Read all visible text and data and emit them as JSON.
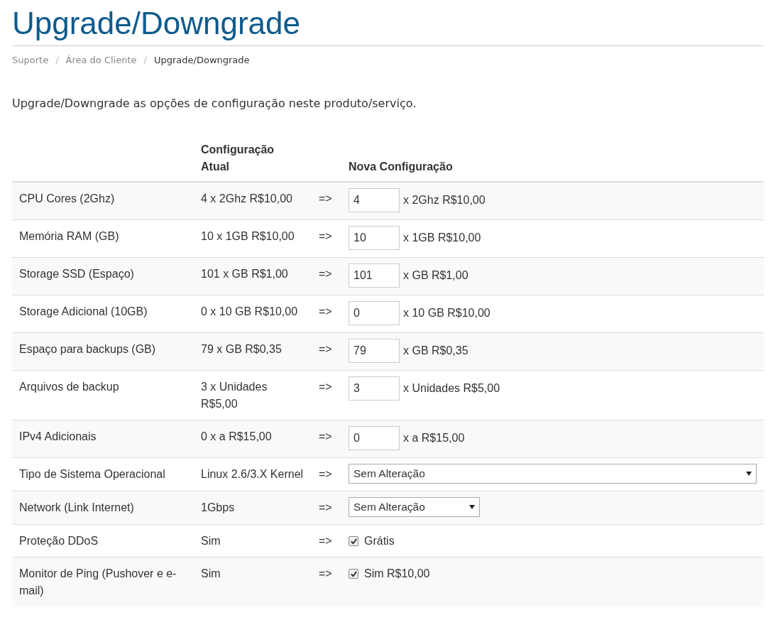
{
  "title": "Upgrade/Downgrade",
  "breadcrumb": [
    {
      "label": "Suporte",
      "current": false
    },
    {
      "label": "Área do Cliente",
      "current": false
    },
    {
      "label": "Upgrade/Downgrade",
      "current": true
    }
  ],
  "breadcrumb_separator": "/",
  "intro": "Upgrade/Downgrade as opções de configuração neste produto/serviço.",
  "table": {
    "columns": [
      "Configuração Atual",
      "Nova Configuração"
    ],
    "rows": [
      {
        "kind": "quantity",
        "label": "CPU Cores (2Ghz)",
        "current": "4 x 2Ghz R$10,00",
        "arrow": "=>",
        "value": "4",
        "suffix": "x 2Ghz R$10,00"
      },
      {
        "kind": "quantity",
        "label": "Memória RAM (GB)",
        "current": "10 x 1GB R$10,00",
        "arrow": "=>",
        "value": "10",
        "suffix": "x 1GB R$10,00"
      },
      {
        "kind": "quantity",
        "label": "Storage SSD (Espaço)",
        "current": "101 x GB R$1,00",
        "arrow": "=>",
        "value": "101",
        "suffix": "x GB R$1,00"
      },
      {
        "kind": "quantity",
        "label": "Storage Adicional (10GB)",
        "current": "0 x 10 GB R$10,00",
        "arrow": "=>",
        "value": "0",
        "suffix": "x 10 GB R$10,00"
      },
      {
        "kind": "quantity",
        "label": "Espaço para backups (GB)",
        "current": "79 x GB R$0,35",
        "arrow": "=>",
        "value": "79",
        "suffix": "x GB R$0,35"
      },
      {
        "kind": "quantity",
        "label": "Arquivos de backup",
        "current": "3 x Unidades R$5,00",
        "arrow": "=>",
        "value": "3",
        "suffix": "x Unidades R$5,00"
      },
      {
        "kind": "quantity",
        "label": "IPv4 Adicionais",
        "current": "0 x a R$15,00",
        "arrow": "=>",
        "value": "0",
        "suffix": "x a R$15,00"
      },
      {
        "kind": "select",
        "label": "Tipo de Sistema Operacional",
        "current": "Linux 2.6/3.X Kernel",
        "arrow": "=>",
        "value": "Sem Alteração",
        "wide": true
      },
      {
        "kind": "select",
        "label": "Network (Link Internet)",
        "current": "1Gbps",
        "arrow": "=>",
        "value": "Sem Alteração",
        "wide": false
      },
      {
        "kind": "checkbox",
        "label": "Proteção DDoS",
        "current": "Sim",
        "arrow": "=>",
        "checked": true,
        "suffix": "Grátis"
      },
      {
        "kind": "checkbox",
        "label": "Monitor de Ping (Pushover e e-mail)",
        "current": "Sim",
        "arrow": "=>",
        "checked": true,
        "suffix": "Sim R$10,00"
      }
    ]
  }
}
